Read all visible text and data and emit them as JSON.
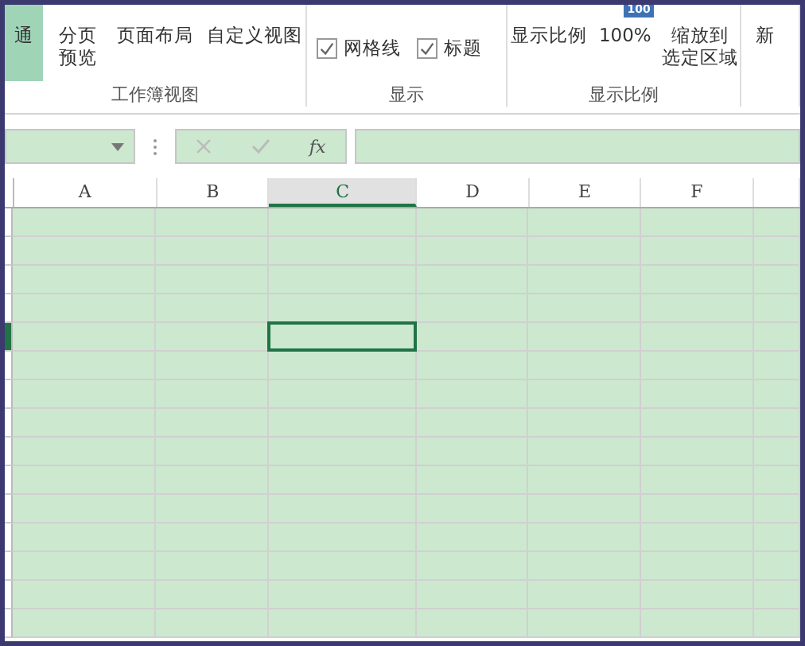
{
  "ribbon": {
    "groups": [
      {
        "label": "工作簿视图",
        "items": [
          {
            "kind": "button",
            "lines": [
              "通"
            ],
            "selected": true
          },
          {
            "kind": "button",
            "lines": [
              "分页",
              "预览"
            ],
            "selected": false
          },
          {
            "kind": "button",
            "lines": [
              "页面布局"
            ],
            "selected": false
          },
          {
            "kind": "button",
            "lines": [
              "自定义视图"
            ],
            "selected": false
          }
        ]
      },
      {
        "label": "显示",
        "items": [
          {
            "kind": "checkbox",
            "lines": [
              "网格线"
            ],
            "checked": true
          },
          {
            "kind": "checkbox",
            "lines": [
              "标题"
            ],
            "checked": true
          }
        ]
      },
      {
        "label": "显示比例",
        "items": [
          {
            "kind": "button",
            "lines": [
              "显示比例"
            ],
            "selected": false
          },
          {
            "kind": "badge-button",
            "badge": "100",
            "lines": [
              "100%"
            ],
            "selected": false
          },
          {
            "kind": "button",
            "lines": [
              "缩放到",
              "选定区域"
            ],
            "selected": false
          }
        ]
      },
      {
        "items": [
          {
            "kind": "button",
            "lines": [
              "新"
            ],
            "selected": false
          }
        ]
      }
    ]
  },
  "formula_bar": {
    "fx_label": "fx"
  },
  "sheet": {
    "columns": [
      {
        "label": "A",
        "selected": false
      },
      {
        "label": "B",
        "selected": false
      },
      {
        "label": "C",
        "selected": true
      },
      {
        "label": "D",
        "selected": false
      },
      {
        "label": "E",
        "selected": false
      },
      {
        "label": "F",
        "selected": false
      },
      {
        "selected": false
      }
    ],
    "rows": [
      {
        "selected": false
      },
      {
        "selected": false
      },
      {
        "selected": false
      },
      {
        "selected": false
      },
      {
        "selected": true
      },
      {
        "selected": false
      },
      {
        "selected": false
      },
      {
        "selected": false
      },
      {
        "selected": false
      },
      {
        "selected": false
      },
      {
        "selected": false
      },
      {
        "selected": false
      },
      {
        "selected": false
      },
      {
        "selected": false
      },
      {
        "selected": false
      }
    ]
  }
}
